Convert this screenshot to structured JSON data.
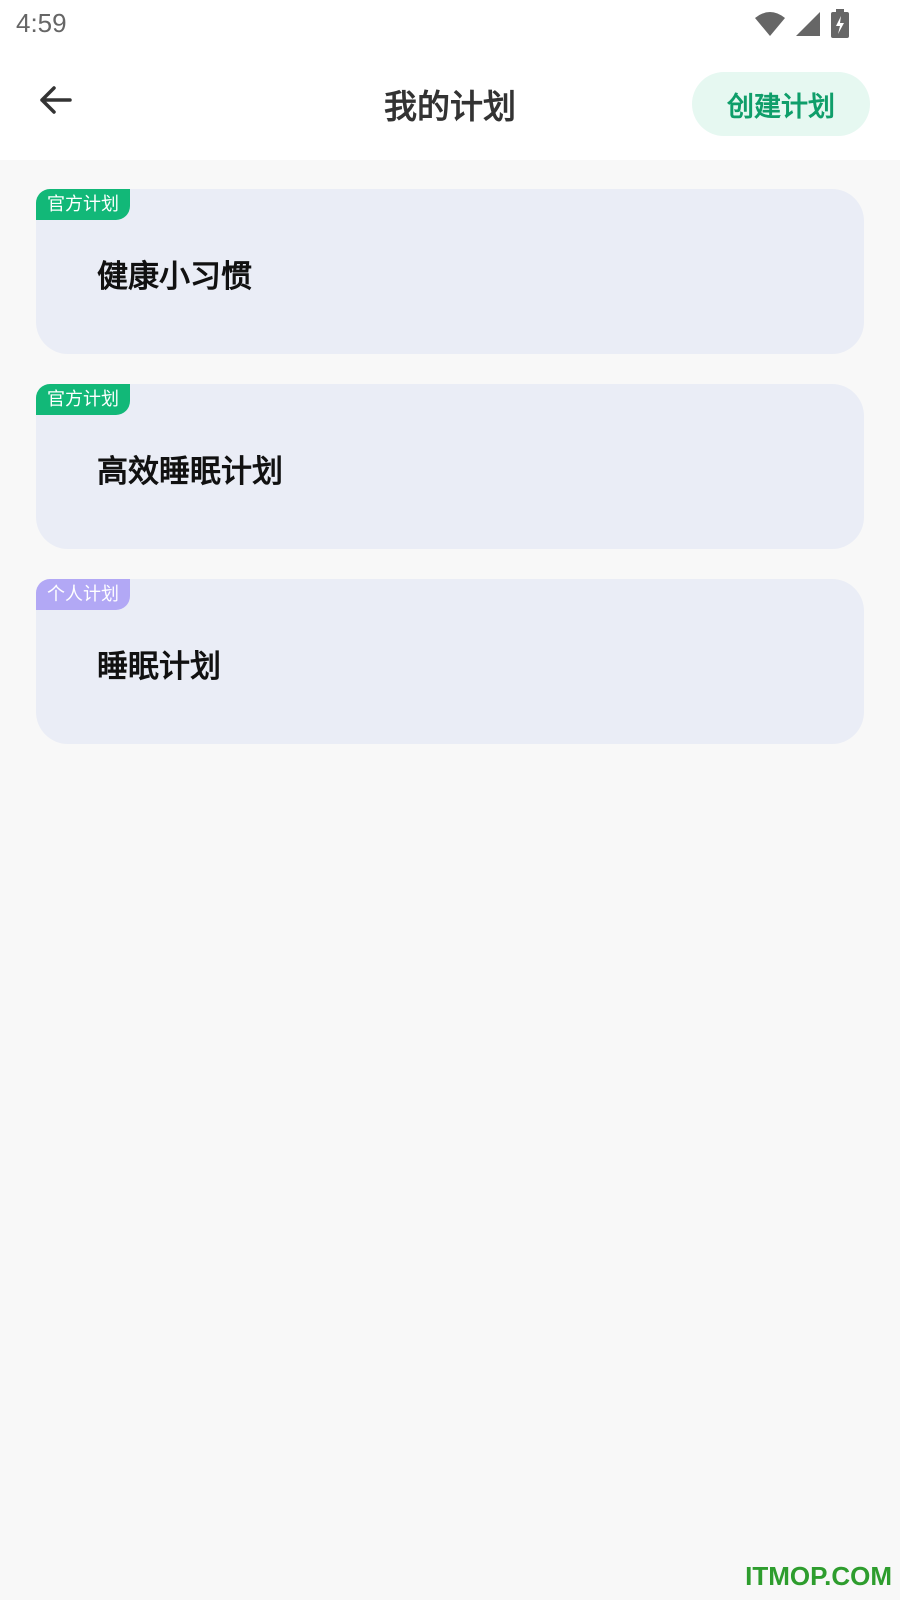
{
  "status_bar": {
    "time": "4:59",
    "icons": [
      "wifi-icon",
      "signal-icon",
      "battery-charging-icon"
    ]
  },
  "header": {
    "title": "我的计划",
    "back_icon": "arrow-left-icon",
    "create_label": "创建计划"
  },
  "plans": [
    {
      "tag": "官方计划",
      "tag_color": "#12b878",
      "title": "健康小习惯"
    },
    {
      "tag": "官方计划",
      "tag_color": "#12b878",
      "title": "高效睡眠计划"
    },
    {
      "tag": "个人计划",
      "tag_color": "#b2a8f5",
      "title": "睡眠计划"
    }
  ],
  "colors": {
    "accent": "#0f9e6a",
    "accent_bg": "#e6f8f1",
    "card_bg": "#eaedf6",
    "page_bg": "#f8f8f8"
  },
  "watermark": "ITMOP.COM"
}
